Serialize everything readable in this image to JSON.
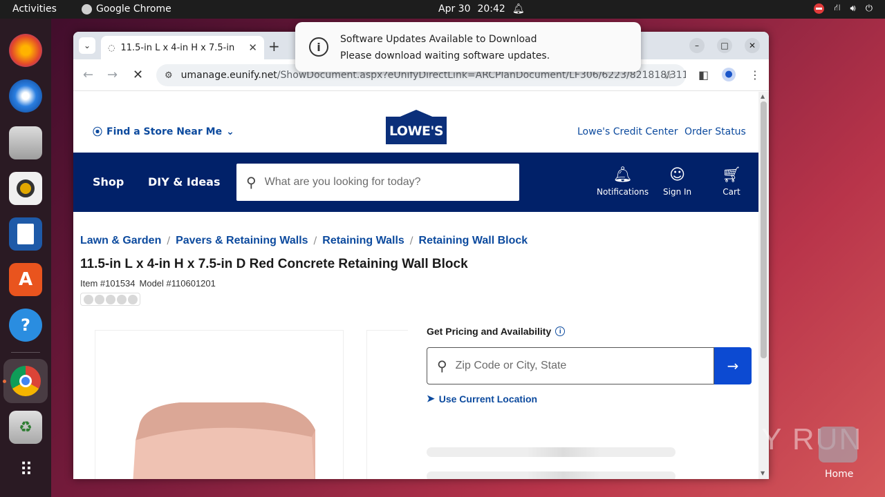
{
  "topbar": {
    "activities": "Activities",
    "app_name": "Google Chrome",
    "date": "Apr 30",
    "time": "20:42"
  },
  "dock": {
    "items": [
      "firefox-icon",
      "thunderbird-icon",
      "files-icon",
      "rhythmbox-icon",
      "writer-icon",
      "app-center-icon",
      "help-icon",
      "chrome-icon",
      "trash-icon",
      "app-grid-icon"
    ]
  },
  "browser": {
    "tab_title": "11.5-in L x 4-in H x 7.5-in",
    "url_host": "umanage.eunify.net",
    "url_path": "/ShowDocument.aspx?eUnifyDirectLink=ARCPlanDocument/LF306/6223/821818/311..."
  },
  "notification": {
    "title": "Software Updates Available to Download",
    "body": "Please download waiting software updates."
  },
  "lowes": {
    "find_store": "Find a Store Near Me",
    "logo_text": "LOWE'S",
    "credit_center": "Lowe's Credit Center",
    "order_status": "Order Status",
    "nav": {
      "shop": "Shop",
      "diy": "DIY & Ideas",
      "search_placeholder": "What are you looking for today?",
      "notifications": "Notifications",
      "sign_in": "Sign In",
      "cart": "Cart"
    },
    "breadcrumb": [
      "Lawn & Garden",
      "Pavers & Retaining Walls",
      "Retaining Walls",
      "Retaining Wall Block"
    ],
    "product": {
      "title": "11.5-in L x 4-in H x 7.5-in D Red Concrete Retaining Wall Block",
      "item": "Item #101534",
      "model": "Model #110601201"
    },
    "pricing": {
      "title": "Get Pricing and Availability",
      "zip_placeholder": "Zip Code or City, State",
      "use_location": "Use Current Location"
    },
    "colors": {
      "brand_blue": "#012169",
      "link_blue": "#0c4a9e",
      "button_blue": "#0c4ad2"
    }
  },
  "desktop": {
    "watermark": "ANY RUN",
    "home_label": "Home"
  }
}
